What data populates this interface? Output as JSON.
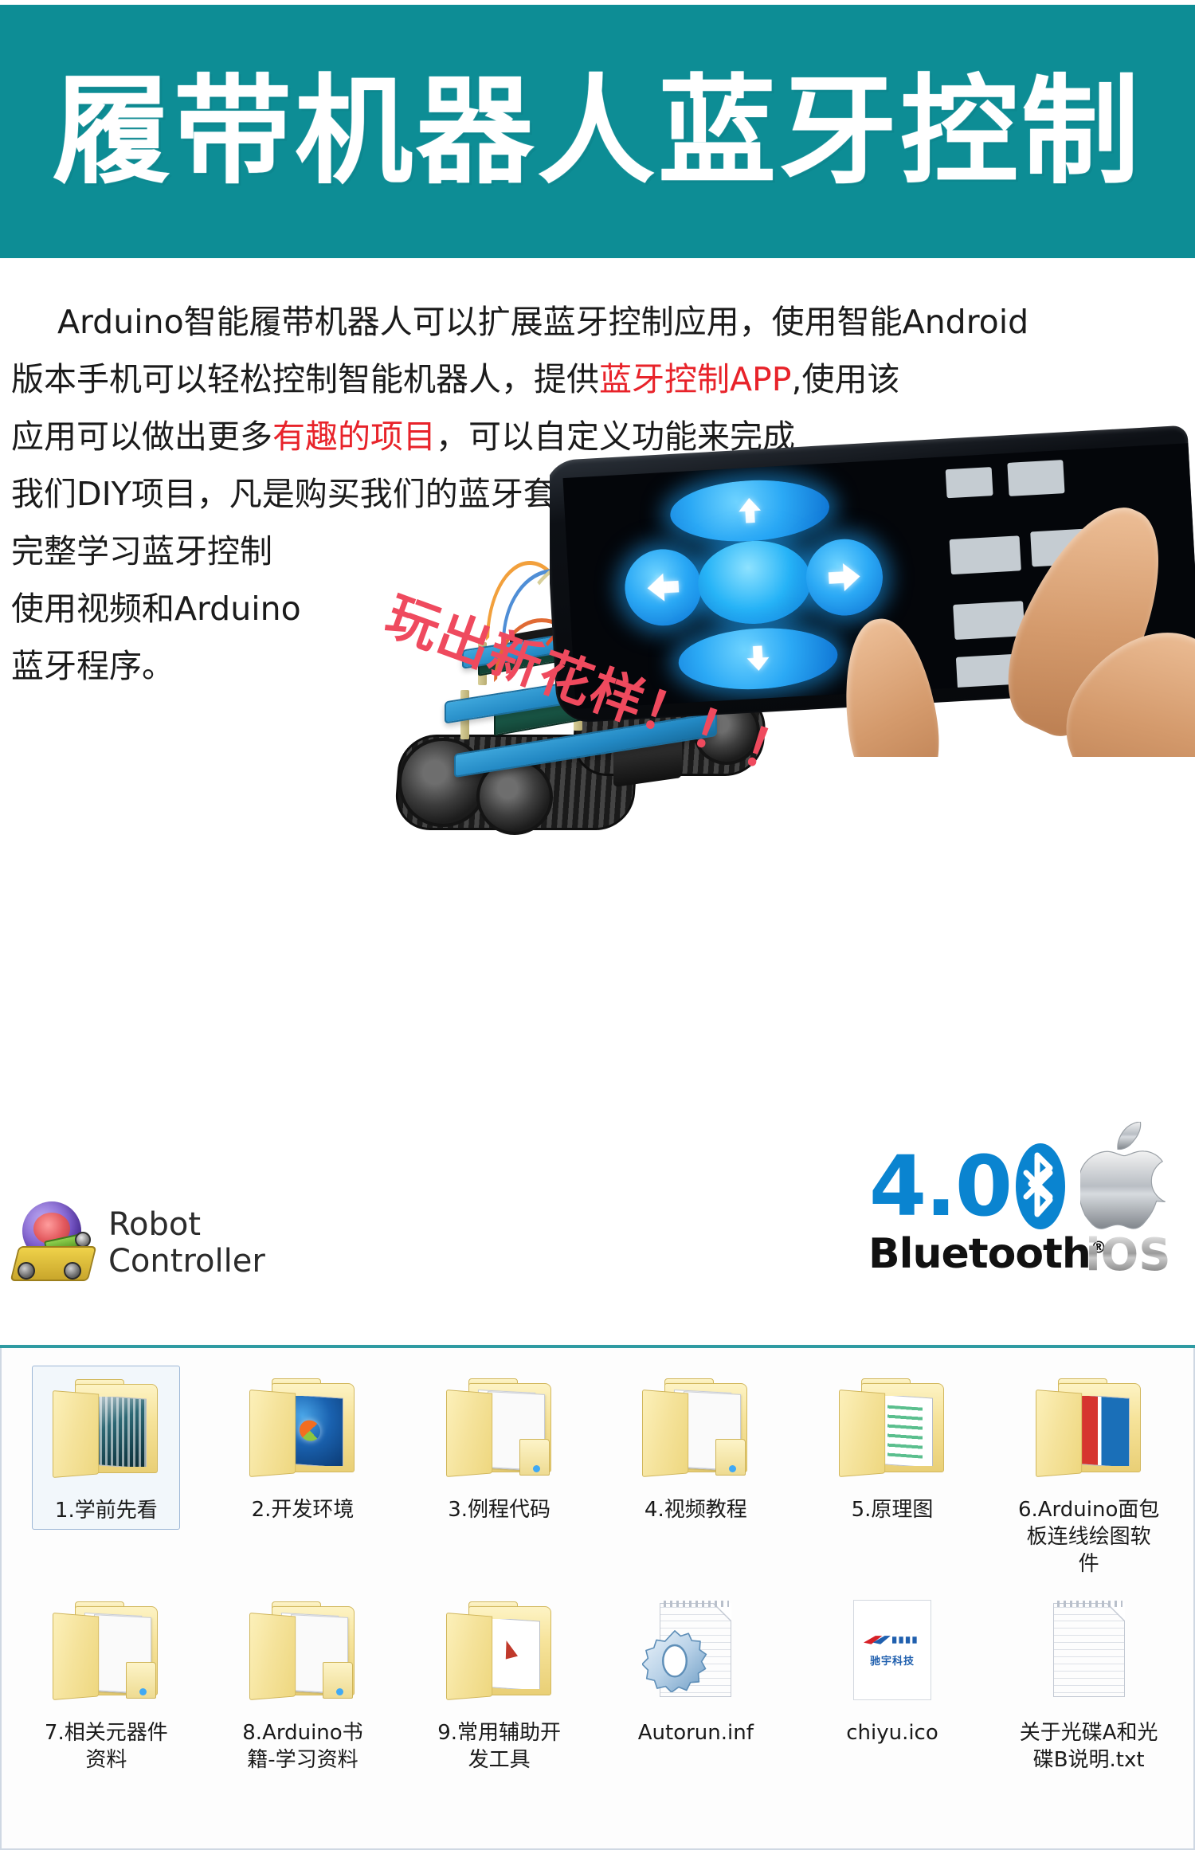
{
  "banner": {
    "title": "履带机器人蓝牙控制",
    "bg_color": "#0d8d95",
    "text_color": "#ffffff"
  },
  "body_copy": {
    "highlight_color": "#e8232a",
    "lines": [
      {
        "id": "l1",
        "pre": "Arduino智能履带机器人可以扩展蓝牙控制应用，使用智能Android",
        "hl": "",
        "post": ""
      },
      {
        "id": "l2",
        "pre": "版本手机可以轻松控制智能机器人，提供",
        "hl": "蓝牙控制APP",
        "post": ",使用该"
      },
      {
        "id": "l3",
        "pre": "应用可以做出更多",
        "hl": "有趣的项目",
        "post": "，可以自定义功能来完成"
      },
      {
        "id": "l4",
        "pre": "我们DIY项目，凡是购买我们的蓝牙套餐，我们会提供",
        "hl": "",
        "post": ""
      },
      {
        "id": "l5",
        "pre": "完整学习蓝牙控制",
        "hl": "",
        "post": ""
      },
      {
        "id": "l6",
        "pre": "使用视频和Arduino",
        "hl": "",
        "post": ""
      },
      {
        "id": "l7",
        "pre": "蓝牙程序。",
        "hl": "",
        "post": ""
      }
    ]
  },
  "slogan": {
    "text": "玩出新花样！！！",
    "color": "#ef4a5e"
  },
  "photos": {
    "robot_alt": "蓝色亚克力履带机器人小车",
    "phone_alt": "手持安卓手机运行蓝牙遥控APP方向键界面"
  },
  "logos": {
    "robot_controller": {
      "line1": "Robot",
      "line2": "Controller"
    },
    "bluetooth": {
      "version": "4.0",
      "word": "Bluetooth",
      "trademark": "®",
      "color": "#0a84d0"
    },
    "ios": {
      "word": "iOS"
    }
  },
  "explorer": {
    "files": [
      {
        "label": "1.学前先看",
        "icon": "folder-pcb",
        "selected": true
      },
      {
        "label": "2.开发环境",
        "icon": "folder-win7",
        "selected": false
      },
      {
        "label": "3.例程代码",
        "icon": "folder-stack",
        "selected": false
      },
      {
        "label": "4.视频教程",
        "icon": "folder-stack",
        "selected": false
      },
      {
        "label": "5.原理图",
        "icon": "folder-doc",
        "selected": false
      },
      {
        "label": "6.Arduino面包板连线绘图软件",
        "icon": "folder-redblue",
        "selected": false
      },
      {
        "label": "7.相关元器件资料",
        "icon": "folder-stack",
        "selected": false
      },
      {
        "label": "8.Arduino书籍-学习资料",
        "icon": "folder-stack",
        "selected": false
      },
      {
        "label": "9.常用辅助开发工具",
        "icon": "folder-arrow",
        "selected": false
      },
      {
        "label": "Autorun.inf",
        "icon": "gear-doc",
        "selected": false
      },
      {
        "label": "chiyu.ico",
        "icon": "ico-file",
        "selected": false
      },
      {
        "label": "关于光碟A和光碟B说明.txt",
        "icon": "text-doc",
        "selected": false
      }
    ],
    "chiyu_icon_text": "驰宇科技"
  }
}
